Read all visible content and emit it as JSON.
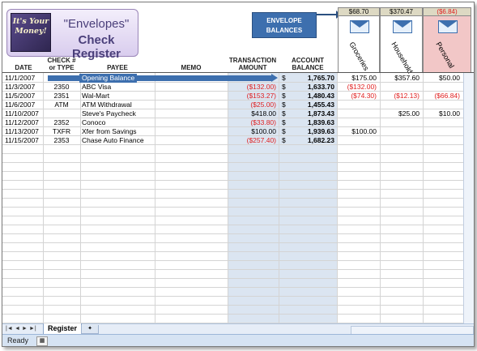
{
  "logo": {
    "badge_text": "It's Your Money!",
    "title_line1": "\"Envelopes\"",
    "title_line2": "Check Register"
  },
  "callout": {
    "text": "ENVELOPE BALANCES"
  },
  "envelopes": [
    {
      "name": "Groceries",
      "balance": "$68.70",
      "negative": false
    },
    {
      "name": "Household",
      "balance": "$370.47",
      "negative": false
    },
    {
      "name": "Personal",
      "balance": "($6.84)",
      "negative": true
    }
  ],
  "headers": {
    "date": "DATE",
    "check_l1": "CHECK #",
    "check_l2": "or TYPE",
    "payee": "PAYEE",
    "memo": "MEMO",
    "amount_l1": "TRANSACTION",
    "amount_l2": "AMOUNT",
    "balance_l1": "ACCOUNT",
    "balance_l2": "BALANCE"
  },
  "rows": [
    {
      "date": "11/1/2007",
      "check": "",
      "payee": "Opening Balance",
      "amount": "",
      "amount_neg": false,
      "balance_sym": "$",
      "balance": "1,765.70",
      "groceries": "$175.00",
      "household": "$357.60",
      "personal": "$50.00",
      "opening": true
    },
    {
      "date": "11/3/2007",
      "check": "2350",
      "payee": "ABC Visa",
      "amount": "($132.00)",
      "amount_neg": true,
      "balance_sym": "$",
      "balance": "1,633.70",
      "groceries": "($132.00)",
      "household": "",
      "personal": ""
    },
    {
      "date": "11/5/2007",
      "check": "2351",
      "payee": "Wal-Mart",
      "amount": "($153.27)",
      "amount_neg": true,
      "balance_sym": "$",
      "balance": "1,480.43",
      "groceries": "($74.30)",
      "household": "($12.13)",
      "personal": "($66.84)"
    },
    {
      "date": "11/6/2007",
      "check": "ATM",
      "payee": "ATM Withdrawal",
      "amount": "($25.00)",
      "amount_neg": true,
      "balance_sym": "$",
      "balance": "1,455.43",
      "groceries": "",
      "household": "",
      "personal": ""
    },
    {
      "date": "11/10/2007",
      "check": "",
      "payee": "Steve's Paycheck",
      "amount": "$418.00",
      "amount_neg": false,
      "balance_sym": "$",
      "balance": "1,873.43",
      "groceries": "",
      "household": "$25.00",
      "personal": "$10.00"
    },
    {
      "date": "11/12/2007",
      "check": "2352",
      "payee": "Conoco",
      "amount": "($33.80)",
      "amount_neg": true,
      "balance_sym": "$",
      "balance": "1,839.63",
      "groceries": "",
      "household": "",
      "personal": ""
    },
    {
      "date": "11/13/2007",
      "check": "TXFR",
      "payee": "Xfer from Savings",
      "amount": "$100.00",
      "amount_neg": false,
      "balance_sym": "$",
      "balance": "1,939.63",
      "groceries": "$100.00",
      "household": "",
      "personal": ""
    },
    {
      "date": "11/15/2007",
      "check": "2353",
      "payee": "Chase Auto Finance",
      "amount": "($257.40)",
      "amount_neg": true,
      "balance_sym": "$",
      "balance": "1,682.23",
      "groceries": "",
      "household": "",
      "personal": ""
    }
  ],
  "sheet_tab": "Register",
  "status": "Ready",
  "colors": {
    "negative": "#e02020",
    "balance_col": "#dbe5f1",
    "personal_header": "#f2c7c7",
    "callout": "#3d6fae"
  }
}
